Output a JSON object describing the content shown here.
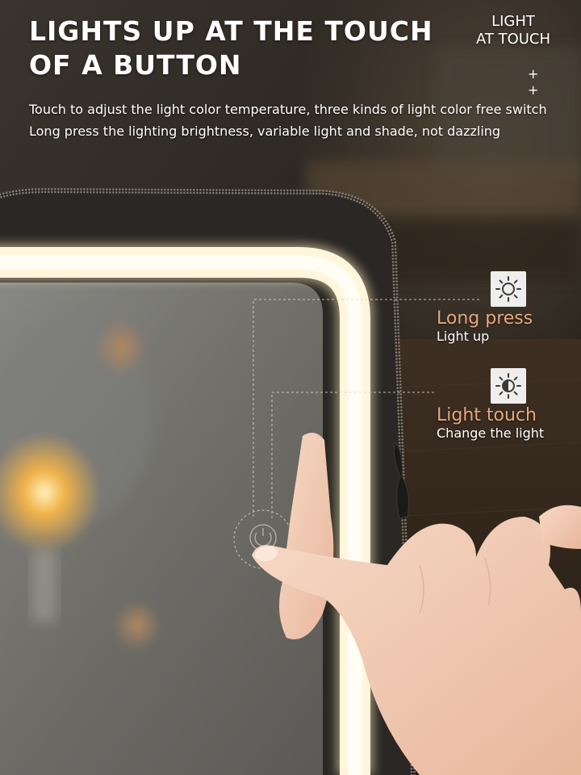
{
  "header": {
    "title": "LIGHTS UP AT THE TOUCH OF A BUTTON",
    "badge_line1": "LIGHT",
    "badge_line2": "AT TOUCH",
    "plus_symbol": "+"
  },
  "description": {
    "line1": "Touch to adjust the light color temperature, three kinds of light color free switch",
    "line2": "Long press the lighting brightness, variable light and shade, not dazzling"
  },
  "features": [
    {
      "icon": "sun-icon",
      "title": "Long press",
      "subtitle": "Light up"
    },
    {
      "icon": "half-sun-icon",
      "title": "Light touch",
      "subtitle": "Change the light"
    }
  ],
  "colors": {
    "accent": "#e7a87c",
    "ring_light": "#fff4d8",
    "background": "#1a1714"
  }
}
